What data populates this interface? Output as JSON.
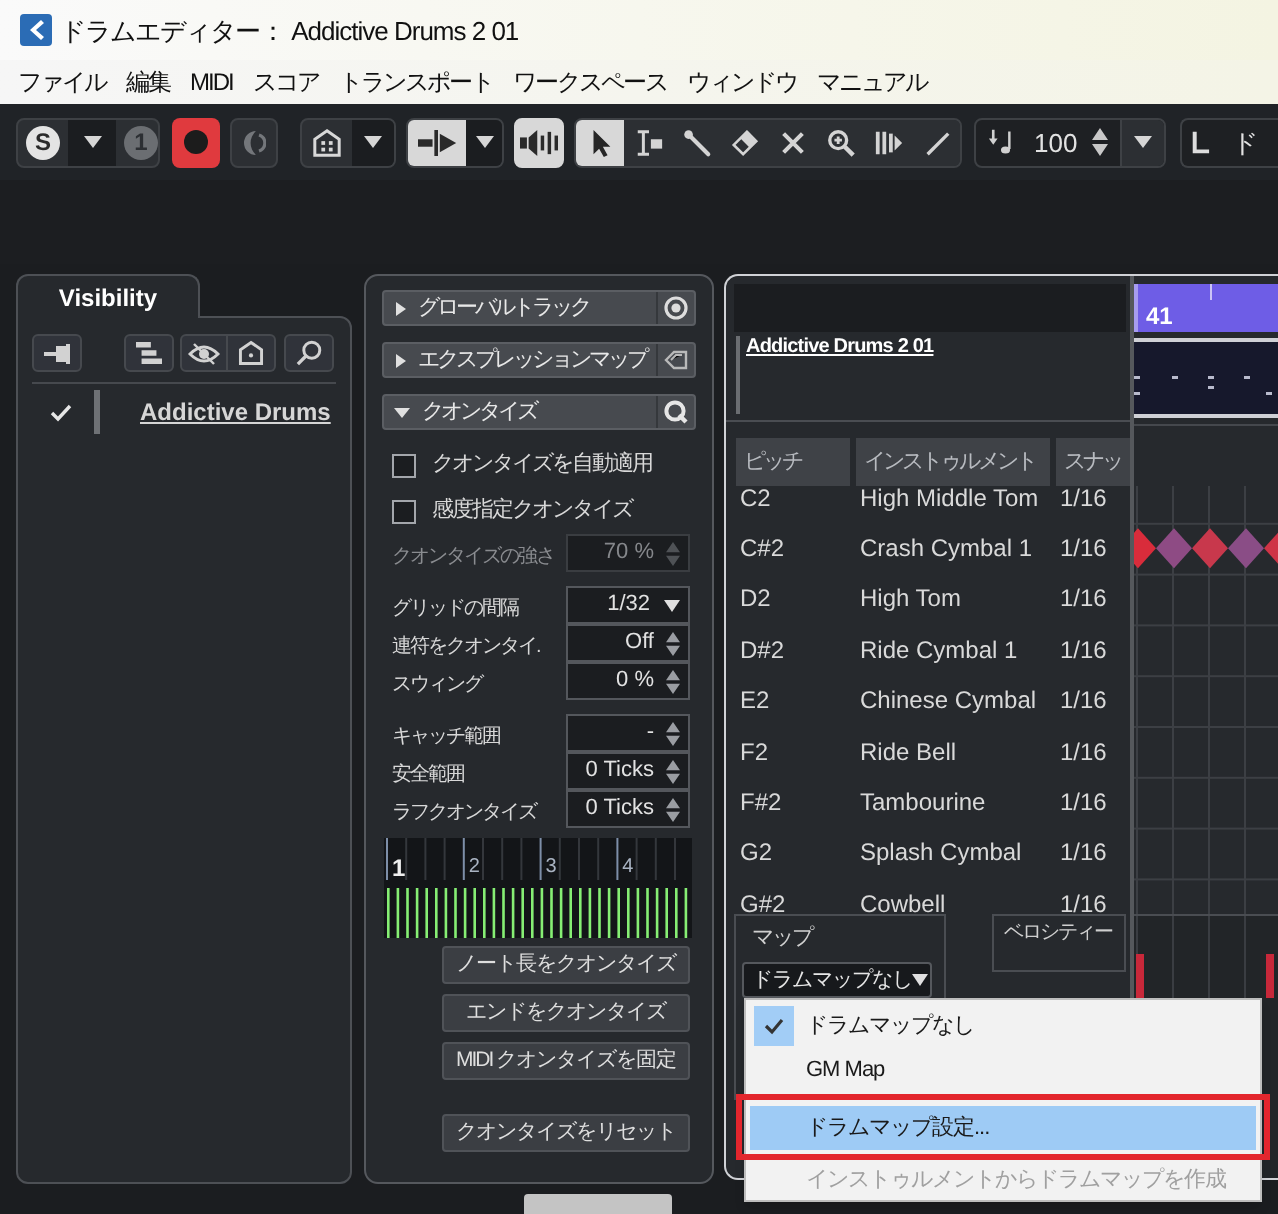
{
  "window": {
    "title": "ドラムエディター： Addictive Drums 2 01"
  },
  "menu": [
    "ファイル",
    "編集",
    "MIDI",
    "スコア",
    "トランスポート",
    "ワークスペース",
    "ウィンドウ",
    "マニュアル"
  ],
  "toolbar": {
    "solo_label": "S",
    "number_label": "1",
    "record": {
      "on": true
    },
    "retrospective_record": {
      "on": false
    },
    "auto_scroll": {
      "on": true
    },
    "acoustic_feedback": {
      "on": true
    },
    "tools": [
      {
        "selected": true
      },
      {
        "selected": false
      },
      {
        "selected": false
      },
      {
        "selected": false
      },
      {
        "selected": false
      },
      {
        "selected": false
      },
      {
        "selected": false
      },
      {
        "selected": false
      }
    ],
    "insert_velocity": "100",
    "cut_label": "ド"
  },
  "visibility_panel": {
    "tab": {
      "label": "Visibility",
      "selected": true
    },
    "tracks": [
      {
        "name": "Addictive Drums",
        "checked": true
      }
    ]
  },
  "inspector": {
    "sections": [
      {
        "title": "グローバルトラック",
        "expanded": false
      },
      {
        "title": "エクスプレッションマップ",
        "expanded": false
      },
      {
        "title": "クオンタイズ",
        "expanded": true,
        "content": {
          "checkboxes": [
            {
              "label": "クオンタイズを自動適用",
              "checked": false
            },
            {
              "label": "感度指定クオンタイズ",
              "checked": false
            }
          ],
          "field_groups": [
            {
              "fields": [
                {
                  "label": "クオンタイズの強さ",
                  "value": "70 %",
                  "kind": "spin",
                  "disabled": true
                }
              ]
            },
            {
              "fields": [
                {
                  "label": "グリッドの間隔",
                  "value": "1/32",
                  "kind": "dropdown",
                  "disabled": false
                },
                {
                  "label": "連符をクオンタイ.",
                  "value": "Off",
                  "kind": "spin",
                  "disabled": false
                },
                {
                  "label": "スウィング",
                  "value": "0 %",
                  "kind": "spin",
                  "disabled": false
                }
              ]
            },
            {
              "fields": [
                {
                  "label": "キャッチ範囲",
                  "value": "-",
                  "kind": "spin",
                  "disabled": false
                },
                {
                  "label": "安全範囲",
                  "value": "0 Ticks",
                  "kind": "spin",
                  "disabled": false
                },
                {
                  "label": "ラフクオンタイズ",
                  "value": "0 Ticks",
                  "kind": "spin",
                  "disabled": false
                }
              ]
            }
          ],
          "grid_labels": [
            "1",
            "2",
            "3",
            "4"
          ],
          "button_groups": [
            [
              "ノート長をクオンタイズ",
              "エンドをクオンタイズ",
              "MIDI クオンタイズを固定"
            ],
            [
              "クオンタイズをリセット"
            ]
          ]
        }
      }
    ]
  },
  "drum_editor": {
    "ruler_label": "41",
    "track_name": "Addictive Drums 2 01",
    "columns": [
      "ピッチ",
      "インストゥルメント",
      "スナッ"
    ],
    "rows": [
      {
        "pitch": "C2",
        "instrument": "High Middle Tom",
        "snap": "1/16"
      },
      {
        "pitch": "C#2",
        "instrument": "Crash Cymbal 1",
        "snap": "1/16",
        "notes": [
          {
            "color": "#d92c3b"
          },
          {
            "color": "#8e4b84"
          },
          {
            "color": "#c8384c"
          },
          {
            "color": "#8a4d86"
          },
          {
            "color": "#cf3446"
          }
        ]
      },
      {
        "pitch": "D2",
        "instrument": "High Tom",
        "snap": "1/16"
      },
      {
        "pitch": "D#2",
        "instrument": "Ride Cymbal 1",
        "snap": "1/16"
      },
      {
        "pitch": "E2",
        "instrument": "Chinese Cymbal",
        "snap": "1/16"
      },
      {
        "pitch": "F2",
        "instrument": "Ride Bell",
        "snap": "1/16"
      },
      {
        "pitch": "F#2",
        "instrument": "Tambourine",
        "snap": "1/16"
      },
      {
        "pitch": "G2",
        "instrument": "Splash Cymbal",
        "snap": "1/16"
      },
      {
        "pitch": "G#2",
        "instrument": "Cowbell",
        "snap": "1/16"
      }
    ],
    "map": {
      "label": "マップ",
      "value": "ドラムマップなし"
    },
    "velocity_label": "ベロシティー"
  },
  "map_menu": {
    "items": [
      {
        "label": "ドラムマップなし",
        "checked": true,
        "selected": false,
        "disabled": false,
        "annotated": false
      },
      {
        "label": "GM Map",
        "checked": false,
        "selected": false,
        "disabled": false,
        "annotated": false
      },
      {
        "label": "ドラムマップ設定...",
        "checked": false,
        "selected": true,
        "disabled": false,
        "annotated": true
      },
      {
        "label": "インストゥルメントからドラムマップを作成",
        "checked": false,
        "selected": false,
        "disabled": true,
        "annotated": false
      }
    ]
  }
}
